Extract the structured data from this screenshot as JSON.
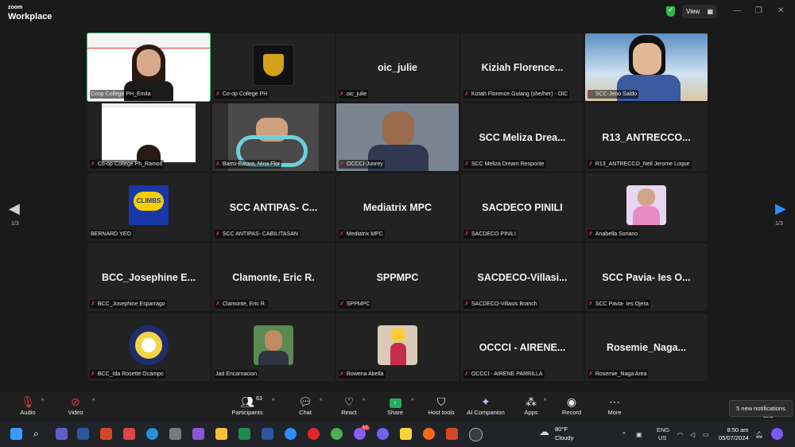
{
  "app": {
    "logo_line1": "zoom",
    "logo_line2": "Workplace",
    "view_label": "View"
  },
  "pagination": {
    "left": "1/3",
    "right": "1/3"
  },
  "tiles": [
    {
      "label": "Coop College PH_Emila",
      "big": "",
      "type": "video-emila",
      "muted": false
    },
    {
      "label": "Co-op College PH",
      "big": "",
      "type": "logo-coop",
      "muted": true
    },
    {
      "label": "oic_julie",
      "big": "oic_julie",
      "type": "text",
      "muted": true
    },
    {
      "label": "Kiziah Florence Gulang (she/her) - OIC",
      "big": "Kiziah  Florence...",
      "type": "text",
      "muted": true
    },
    {
      "label": "SCC-Jeno Saldo",
      "big": "",
      "type": "video-jeno",
      "muted": true
    },
    {
      "label": "Co-op College Ph_Ramos",
      "big": "",
      "type": "video-ramos",
      "muted": true
    },
    {
      "label": "Barro-Batara, Nina Flor",
      "big": "",
      "type": "video-car",
      "muted": true
    },
    {
      "label": "OCCCI-Junrey",
      "big": "",
      "type": "video-junrey",
      "muted": true
    },
    {
      "label": "SCC Meliza Dream Responte",
      "big": "SCC  Meliza  Drea...",
      "type": "text",
      "muted": true
    },
    {
      "label": "R13_ANTRECCO_Neil Jerome Loque",
      "big": "R13_ANTRECCO...",
      "type": "text",
      "muted": true
    },
    {
      "label": "BERNARD YEO",
      "big": "",
      "type": "logo-climbs",
      "muted": false
    },
    {
      "label": "SCC ANTIPAS- CABILITASAN",
      "big": "SCC  ANTIPAS-  C...",
      "type": "text",
      "muted": true
    },
    {
      "label": "Mediatrix MPC",
      "big": "Mediatrix MPC",
      "type": "text",
      "muted": true
    },
    {
      "label": "SACDECO PINILI",
      "big": "SACDECO PINILI",
      "type": "text",
      "muted": true
    },
    {
      "label": "Anabella Soriano",
      "big": "",
      "type": "photo-anabella",
      "muted": true
    },
    {
      "label": "BCC_Josephine Esparrago",
      "big": "BCC_Josephine  E...",
      "type": "text",
      "muted": true
    },
    {
      "label": "Clamonte, Eric R.",
      "big": "Clamonte, Eric R.",
      "type": "text",
      "muted": true
    },
    {
      "label": "SPPMPC",
      "big": "SPPMPC",
      "type": "text",
      "muted": true
    },
    {
      "label": "SACDECO-Villasis Branch",
      "big": "SACDECO-Villasi...",
      "type": "text",
      "muted": true
    },
    {
      "label": "SCC Pavia- Ies Ojera",
      "big": "SCC  Pavia-  Ies  O...",
      "type": "text",
      "muted": true
    },
    {
      "label": "BCC_Ida Rosette Ocampo",
      "big": "",
      "type": "logo-seal",
      "muted": true
    },
    {
      "label": "Jad Encarnacion",
      "big": "",
      "type": "photo-jad",
      "muted": false
    },
    {
      "label": "Rowena Abella",
      "big": "",
      "type": "photo-rowena",
      "muted": true
    },
    {
      "label": "OCCCI - AIRENE PARRILLA",
      "big": "OCCCI  -  AIRENE...",
      "type": "text",
      "muted": true
    },
    {
      "label": "Rosemie_Naga Area",
      "big": "Rosemie_Naga...",
      "type": "text",
      "muted": true
    }
  ],
  "climbs_text": "CLIMBS",
  "toolbar": {
    "audio": "Audio",
    "video": "Video",
    "participants": "Participants",
    "participants_count": "63",
    "chat": "Chat",
    "react": "React",
    "share": "Share",
    "host_tools": "Host tools",
    "ai_companion": "AI Companion",
    "apps": "Apps",
    "record": "Record",
    "more": "More",
    "end": "End"
  },
  "notification": "5 new notifications",
  "taskbar": {
    "temp": "80°F",
    "condition": "Cloudy",
    "lang1": "ENG",
    "lang2": "US",
    "time": "8:50 am",
    "date": "05/07/2024",
    "messenger_badge": "10"
  },
  "colors": {
    "active_speaker": "#2bd37e",
    "muted_icon": "#e23b3b",
    "share_green": "#1fae5b"
  }
}
